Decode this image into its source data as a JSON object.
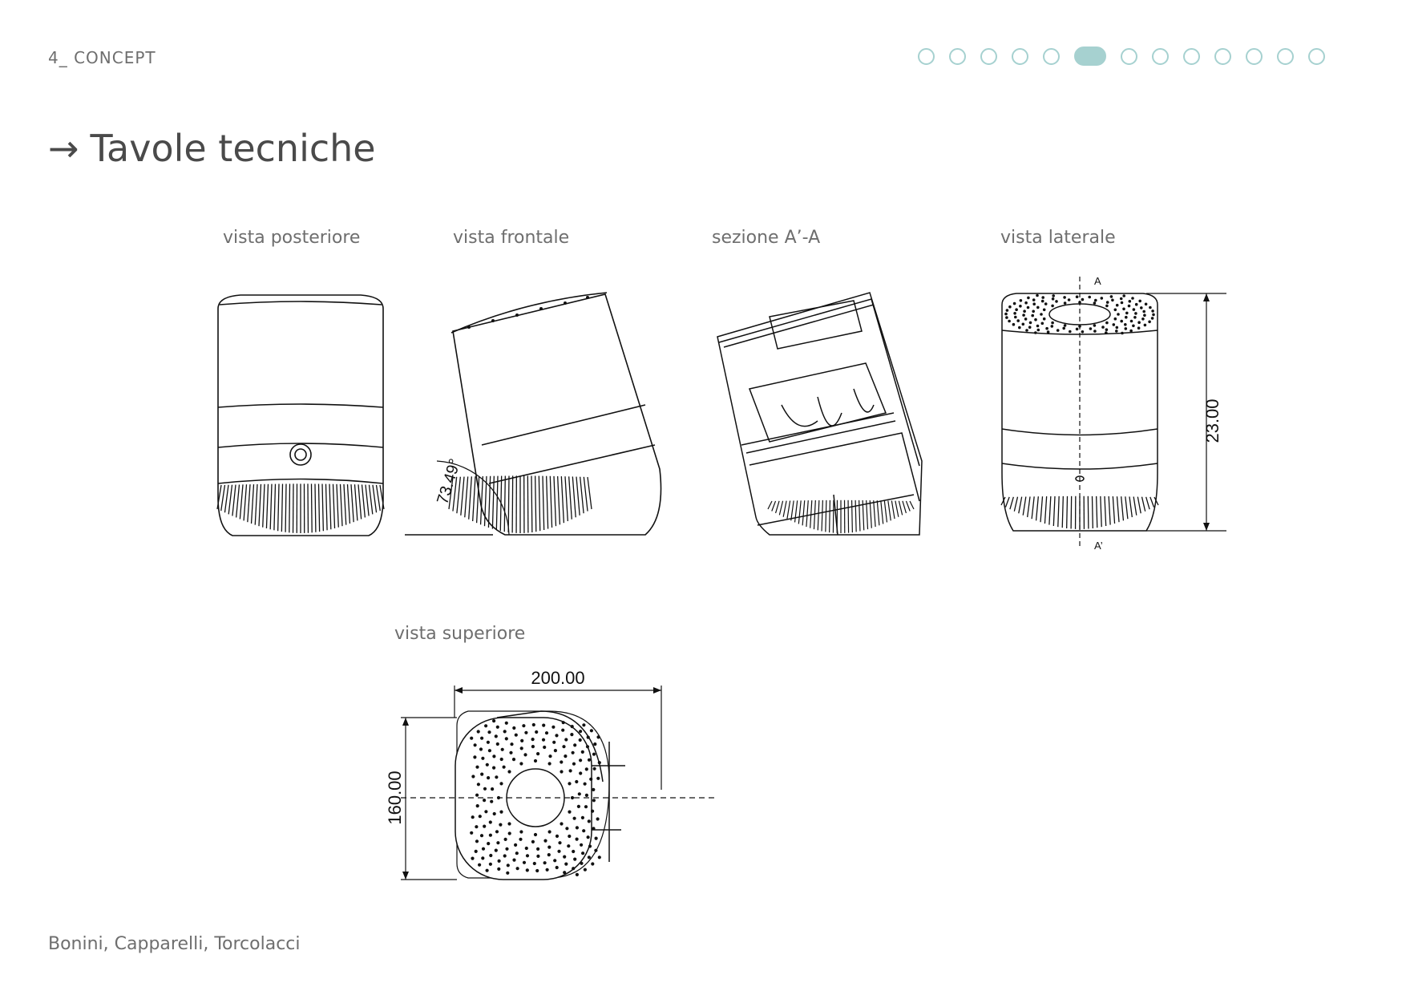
{
  "header": {
    "section": "4_ CONCEPT",
    "title_arrow": "→",
    "title": "Tavole tecniche"
  },
  "pager": {
    "total": 13,
    "active_index": 5,
    "accent": "#a6d1d0"
  },
  "views": {
    "posteriore": "vista posteriore",
    "frontale": "vista frontale",
    "sezione": "sezione A’-A",
    "laterale": "vista laterale",
    "superiore": "vista superiore"
  },
  "dimensions": {
    "angle": "73.49°",
    "height": "23.00",
    "width": "200.00",
    "depth": "160.00",
    "section_top": "A",
    "section_bottom": "A’"
  },
  "footer": {
    "authors": "Bonini, Capparelli, Torcolacci"
  }
}
